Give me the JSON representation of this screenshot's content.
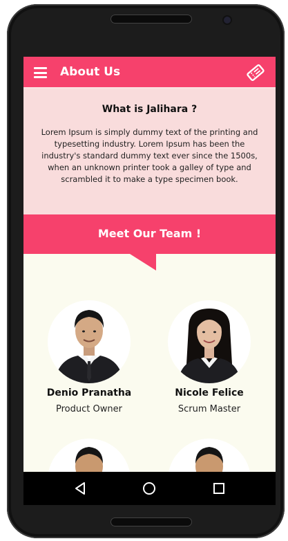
{
  "appbar": {
    "title": "About Us",
    "menu_icon": "hamburger-menu-icon",
    "action_icon": "ticket-icon"
  },
  "about": {
    "heading": "What is Jalihara ?",
    "body": "Lorem Ipsum is simply dummy text of the printing and typesetting industry. Lorem Ipsum has been the industry's standard dummy text ever since the 1500s, when an unknown printer took a galley of type and scrambled it to make a type specimen book."
  },
  "team": {
    "title": "Meet Our Team !",
    "members": [
      {
        "name": "Denio Pranatha",
        "role": "Product Owner"
      },
      {
        "name": "Nicole Felice",
        "role": "Scrum Master"
      }
    ]
  },
  "navbar": {
    "back_icon": "back-triangle-icon",
    "home_icon": "home-circle-icon",
    "recents_icon": "recents-square-icon"
  },
  "colors": {
    "accent": "#f6416c",
    "about_bg": "#f9dcdc",
    "page_bg": "#fbfbef"
  }
}
